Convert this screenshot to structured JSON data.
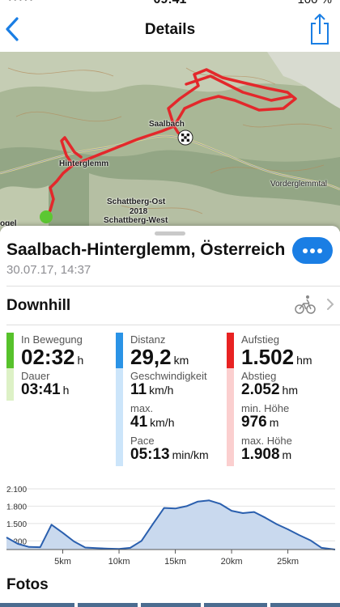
{
  "status_bar": {
    "time": "09:41",
    "battery": "100 %"
  },
  "nav": {
    "title": "Details",
    "back_icon": "chevron-left-icon",
    "share_icon": "share-icon"
  },
  "map": {
    "labels": {
      "saalbach": "Saalbach",
      "hinterglemm": "Hinterglemm",
      "schattberg_ost": "Schattberg-Ost",
      "elev_2018": "2018",
      "schattberg_west": "Schattberg-West",
      "vorderglemmtal": "Vorderglemmtal",
      "edge_left": "ogel"
    },
    "route_color": "#e3282b",
    "start_marker_color": "#5cc732"
  },
  "activity": {
    "location": "Saalbach-Hinterglemm, Österreich",
    "datetime": "30.07.17, 14:37",
    "type": "Downhill",
    "type_icon": "bike-icon"
  },
  "stats": {
    "motion": {
      "color": "#57c22b",
      "light_color": "#ddf1c6",
      "label": "In Bewegung",
      "value": "02:32",
      "unit": "h",
      "duration_label": "Dauer",
      "duration_value": "03:41",
      "duration_unit": "h"
    },
    "distance": {
      "color": "#2a93e6",
      "light_color": "#cce5fa",
      "label": "Distanz",
      "value": "29,2",
      "unit": "km",
      "speed_label": "Geschwindigkeit",
      "speed_value": "11",
      "speed_unit": "km/h",
      "max_label": "max.",
      "max_value": "41",
      "max_unit": "km/h",
      "pace_label": "Pace",
      "pace_value": "05:13",
      "pace_unit": "min/km"
    },
    "ascent": {
      "color": "#e82222",
      "light_color": "#fbcfcf",
      "label": "Aufstieg",
      "value": "1.502",
      "unit": "hm",
      "descent_label": "Abstieg",
      "descent_value": "2.052",
      "descent_unit": "hm",
      "min_label": "min. Höhe",
      "min_value": "976",
      "min_unit": "m",
      "max_label": "max. Höhe",
      "max_value": "1.908",
      "max_unit": "m"
    }
  },
  "chart_data": {
    "type": "area",
    "x": [
      0,
      1,
      2,
      3,
      4,
      5,
      6,
      7,
      8,
      9,
      10,
      11,
      12,
      13,
      14,
      15,
      16,
      17,
      18,
      19,
      20,
      21,
      22,
      23,
      24,
      25,
      26,
      27,
      28,
      29.2
    ],
    "y": [
      1260,
      1150,
      1095,
      1090,
      1480,
      1340,
      1190,
      1085,
      1075,
      1065,
      1060,
      1080,
      1200,
      1490,
      1770,
      1760,
      1800,
      1880,
      1900,
      1840,
      1720,
      1680,
      1700,
      1600,
      1490,
      1400,
      1300,
      1210,
      1080,
      1050
    ],
    "xlim": [
      0,
      29.2
    ],
    "ylim": [
      1050,
      2100
    ],
    "yticks": [
      "2.100",
      "1.800",
      "1.500",
      "1.200"
    ],
    "ytick_values": [
      2100,
      1800,
      1500,
      1200
    ],
    "xticks": [
      "5km",
      "10km",
      "15km",
      "20km",
      "25km"
    ],
    "xtick_values": [
      5,
      10,
      15,
      20,
      25
    ],
    "line_color": "#2a5fae",
    "fill_color": "#c9d9ee",
    "grid": true
  },
  "photos": {
    "title": "Fotos"
  }
}
